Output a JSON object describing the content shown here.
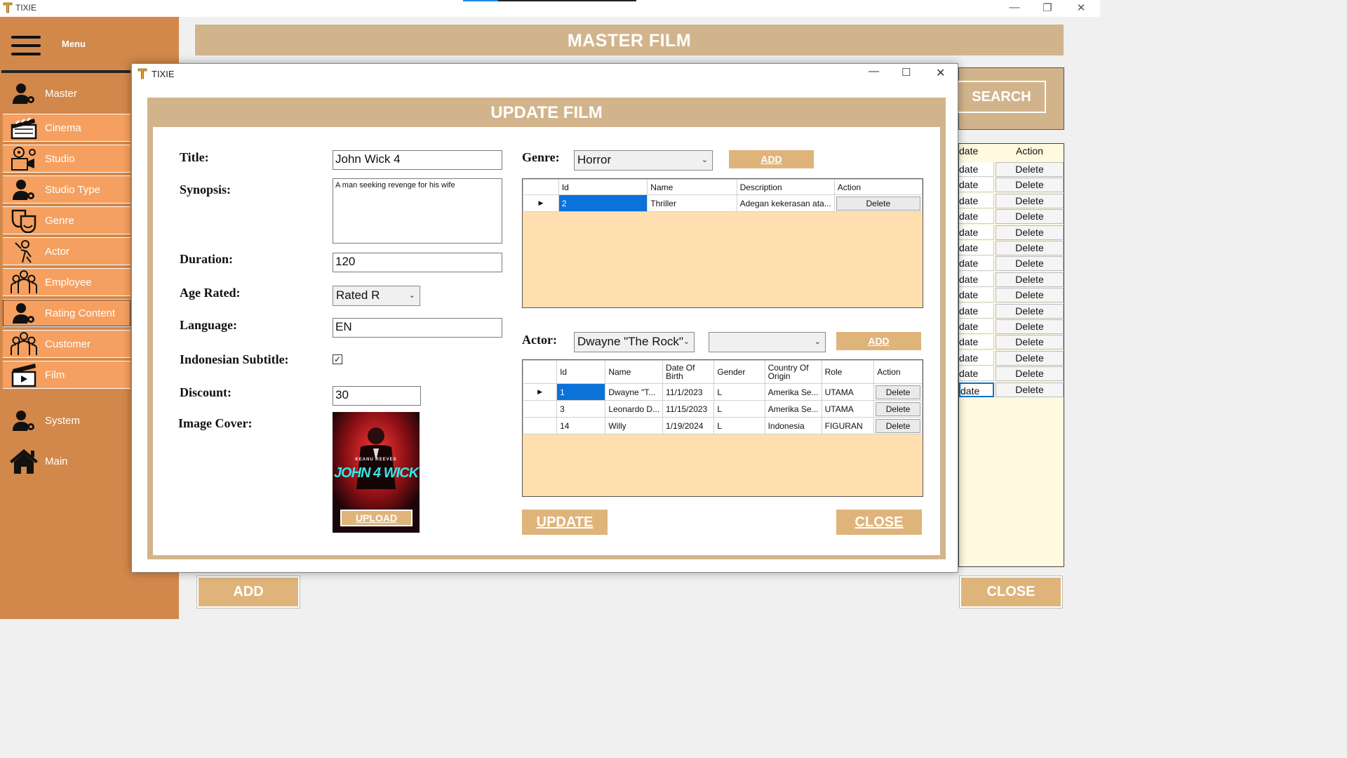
{
  "window": {
    "title": "TIXIE"
  },
  "sidebar": {
    "menu_label": "Menu",
    "items": [
      {
        "label": "Master",
        "icon": "user-gear-icon"
      },
      {
        "label": "Cinema",
        "icon": "clapperboard-icon"
      },
      {
        "label": "Studio",
        "icon": "studio-icon"
      },
      {
        "label": "Studio Type",
        "icon": "user-gear-icon"
      },
      {
        "label": "Genre",
        "icon": "theater-masks-icon"
      },
      {
        "label": "Actor",
        "icon": "actor-icon"
      },
      {
        "label": "Employee",
        "icon": "group-icon"
      },
      {
        "label": "Rating Content",
        "icon": "user-gear-icon"
      },
      {
        "label": "Customer",
        "icon": "group-icon"
      },
      {
        "label": "Film",
        "icon": "film-icon"
      },
      {
        "label": "System",
        "icon": "user-gear-icon"
      },
      {
        "label": "Main",
        "icon": "home-icon"
      }
    ]
  },
  "background": {
    "header_title": "MASTER FILM",
    "search_label": "SEARCH",
    "grid_header_update": "date",
    "grid_header_action": "Action",
    "row_update_label": "date",
    "row_action_label": "Delete",
    "row_count": 15,
    "add_label": "ADD",
    "close_label": "CLOSE"
  },
  "dialog": {
    "title": "TIXIE",
    "heading": "UPDATE FILM",
    "form": {
      "title_label": "Title:",
      "title_value": "John Wick 4",
      "synopsis_label": "Synopsis:",
      "synopsis_value": "A man seeking revenge for his wife",
      "duration_label": "Duration:",
      "duration_value": "120",
      "age_label": "Age Rated:",
      "age_value": "Rated R",
      "language_label": "Language:",
      "language_value": "EN",
      "subtitle_label": "Indonesian Subtitle:",
      "subtitle_checked": true,
      "discount_label": "Discount:",
      "discount_value": "30",
      "image_label": "Image Cover:",
      "poster_top_text": "KEANU REEVES",
      "poster_title_text": "JOHN 4 WICK",
      "upload_label": "UPLOAD"
    },
    "genre": {
      "label": "Genre:",
      "selected": "Horror",
      "add_label": "ADD",
      "columns": [
        "Id",
        "Name",
        "Description",
        "Action"
      ],
      "rows": [
        {
          "id": "2",
          "name": "Thriller",
          "description": "Adegan kekerasan ata...",
          "action": "Delete"
        }
      ]
    },
    "actor": {
      "label": "Actor:",
      "selected": "Dwayne \"The Rock\"",
      "role_selected": "",
      "add_label": "ADD",
      "columns": [
        "Id",
        "Name",
        "Date Of Birth",
        "Gender",
        "Country Of Origin",
        "Role",
        "Action"
      ],
      "rows": [
        {
          "id": "1",
          "name": "Dwayne \"T...",
          "dob": "11/1/2023",
          "gender": "L",
          "country": "Amerika Se...",
          "role": "UTAMA",
          "action": "Delete"
        },
        {
          "id": "3",
          "name": "Leonardo D...",
          "dob": "11/15/2023",
          "gender": "L",
          "country": "Amerika Se...",
          "role": "UTAMA",
          "action": "Delete"
        },
        {
          "id": "14",
          "name": "Willy",
          "dob": "1/19/2024",
          "gender": "L",
          "country": "Indonesia",
          "role": "FIGURAN",
          "action": "Delete"
        }
      ]
    },
    "update_label": "UPDATE",
    "close_label": "CLOSE"
  },
  "colors": {
    "sidebar": "#d2884a",
    "nav_item": "#f5a060",
    "tan": "#d2b48c",
    "button": "#dfb47a",
    "grid_bg": "#ffdfb0",
    "selection": "#0a72d8"
  }
}
